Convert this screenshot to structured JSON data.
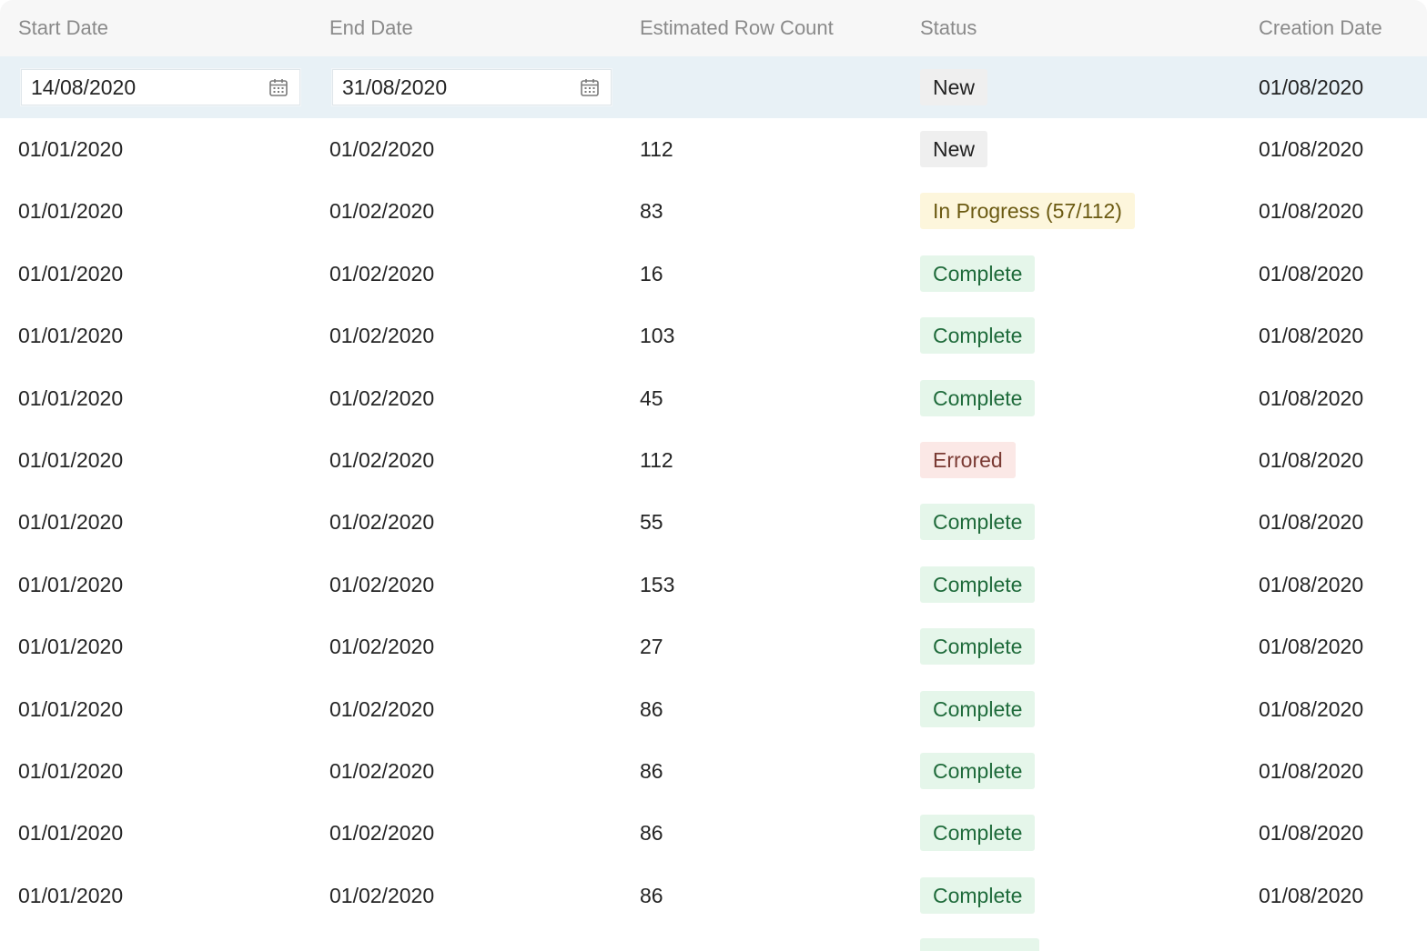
{
  "columns": {
    "start_date": "Start Date",
    "end_date": "End Date",
    "estimated_row_count": "Estimated Row Count",
    "status": "Status",
    "creation_date": "Creation Date"
  },
  "new_row": {
    "start_date_value": "14/08/2020",
    "end_date_value": "31/08/2020",
    "start_date_icon": "calendar-icon",
    "end_date_icon": "calendar-icon",
    "status": "New",
    "creation_date": "01/08/2020"
  },
  "status_colors": {
    "new": "#efefef",
    "in_progress": "#fdf6dc",
    "complete": "#e5f6ea",
    "errored": "#fbe8e6",
    "selected_row": "#e8f1f6"
  },
  "rows": [
    {
      "start": "01/01/2020",
      "end": "01/02/2020",
      "count": "112",
      "status": "New",
      "status_type": "new",
      "created": "01/08/2020"
    },
    {
      "start": "01/01/2020",
      "end": "01/02/2020",
      "count": "83",
      "status": "In Progress (57/112)",
      "status_type": "progress",
      "created": "01/08/2020"
    },
    {
      "start": "01/01/2020",
      "end": "01/02/2020",
      "count": "16",
      "status": "Complete",
      "status_type": "complete",
      "created": "01/08/2020"
    },
    {
      "start": "01/01/2020",
      "end": "01/02/2020",
      "count": "103",
      "status": "Complete",
      "status_type": "complete",
      "created": "01/08/2020"
    },
    {
      "start": "01/01/2020",
      "end": "01/02/2020",
      "count": "45",
      "status": "Complete",
      "status_type": "complete",
      "created": "01/08/2020"
    },
    {
      "start": "01/01/2020",
      "end": "01/02/2020",
      "count": "112",
      "status": "Errored",
      "status_type": "errored",
      "created": "01/08/2020"
    },
    {
      "start": "01/01/2020",
      "end": "01/02/2020",
      "count": "55",
      "status": "Complete",
      "status_type": "complete",
      "created": "01/08/2020"
    },
    {
      "start": "01/01/2020",
      "end": "01/02/2020",
      "count": "153",
      "status": "Complete",
      "status_type": "complete",
      "created": "01/08/2020"
    },
    {
      "start": "01/01/2020",
      "end": "01/02/2020",
      "count": "27",
      "status": "Complete",
      "status_type": "complete",
      "created": "01/08/2020"
    },
    {
      "start": "01/01/2020",
      "end": "01/02/2020",
      "count": "86",
      "status": "Complete",
      "status_type": "complete",
      "created": "01/08/2020"
    },
    {
      "start": "01/01/2020",
      "end": "01/02/2020",
      "count": "86",
      "status": "Complete",
      "status_type": "complete",
      "created": "01/08/2020"
    },
    {
      "start": "01/01/2020",
      "end": "01/02/2020",
      "count": "86",
      "status": "Complete",
      "status_type": "complete",
      "created": "01/08/2020"
    },
    {
      "start": "01/01/2020",
      "end": "01/02/2020",
      "count": "86",
      "status": "Complete",
      "status_type": "complete",
      "created": "01/08/2020"
    }
  ]
}
